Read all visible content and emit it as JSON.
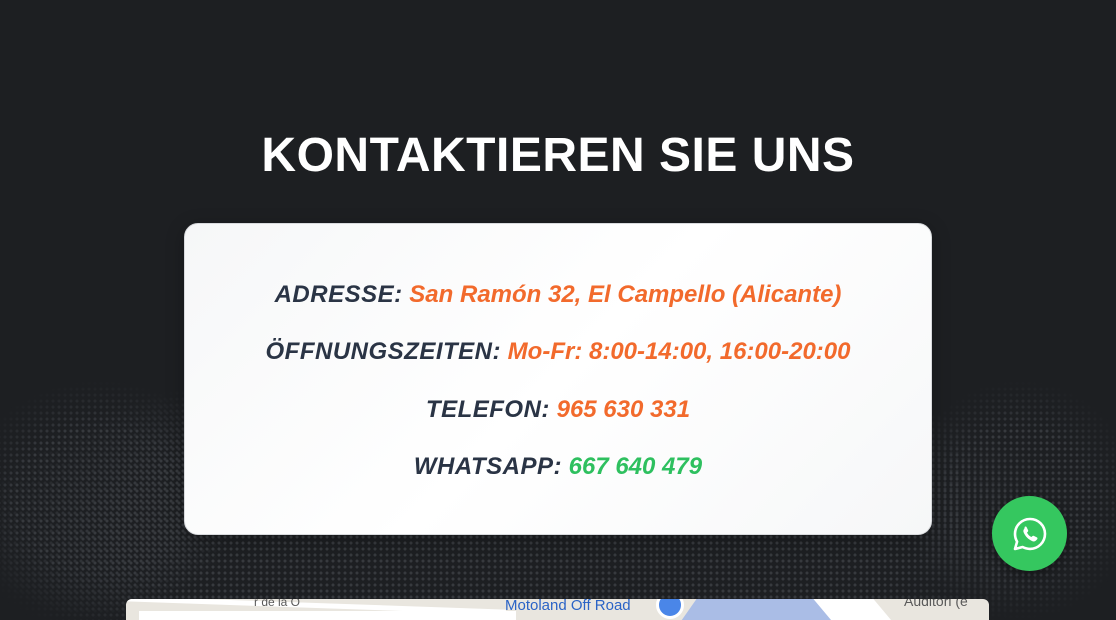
{
  "section": {
    "title": "KONTAKTIEREN SIE UNS"
  },
  "contact": {
    "address_label": "ADRESSE:",
    "address_value": "San Ramón 32, El Campello (Alicante)",
    "hours_label": "ÖFFNUNGSZEITEN:",
    "hours_value": "Mo-Fr: 8:00-14:00, 16:00-20:00",
    "phone_label": "TELEFON:",
    "phone_value": "965 630 331",
    "whatsapp_label": "WHATSAPP:",
    "whatsapp_value": "667 640 479"
  },
  "map": {
    "poi_label": "Motoland Off Road",
    "street_label": "r de la O",
    "right_label": "Auditori (e"
  },
  "floating": {
    "icon": "whatsapp-icon"
  },
  "colors": {
    "background": "#1d1f22",
    "accent_orange": "#f26a2c",
    "accent_green": "#2ec05f",
    "label_dark": "#2a3445",
    "whatsapp_green": "#35c75f"
  }
}
